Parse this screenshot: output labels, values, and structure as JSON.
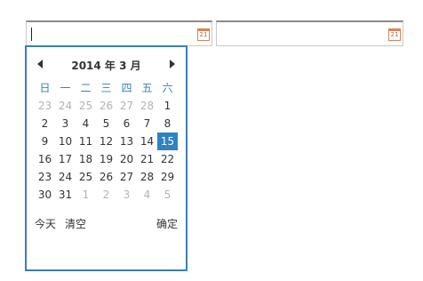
{
  "inputs": [
    {
      "value": "",
      "icon_text": "21"
    },
    {
      "value": "",
      "icon_text": "21"
    }
  ],
  "calendar": {
    "title": "2014 年 3 月",
    "weekdays": [
      "日",
      "一",
      "二",
      "三",
      "四",
      "五",
      "六"
    ],
    "weeks": [
      [
        {
          "d": "23",
          "m": true
        },
        {
          "d": "24",
          "m": true
        },
        {
          "d": "25",
          "m": true
        },
        {
          "d": "26",
          "m": true
        },
        {
          "d": "27",
          "m": true
        },
        {
          "d": "28",
          "m": true
        },
        {
          "d": "1"
        }
      ],
      [
        {
          "d": "2"
        },
        {
          "d": "3"
        },
        {
          "d": "4"
        },
        {
          "d": "5"
        },
        {
          "d": "6"
        },
        {
          "d": "7"
        },
        {
          "d": "8"
        }
      ],
      [
        {
          "d": "9"
        },
        {
          "d": "10"
        },
        {
          "d": "11"
        },
        {
          "d": "12"
        },
        {
          "d": "13"
        },
        {
          "d": "14"
        },
        {
          "d": "15",
          "s": true
        }
      ],
      [
        {
          "d": "16"
        },
        {
          "d": "17"
        },
        {
          "d": "18"
        },
        {
          "d": "19"
        },
        {
          "d": "20"
        },
        {
          "d": "21"
        },
        {
          "d": "22"
        }
      ],
      [
        {
          "d": "23"
        },
        {
          "d": "24"
        },
        {
          "d": "25"
        },
        {
          "d": "26"
        },
        {
          "d": "27"
        },
        {
          "d": "28"
        },
        {
          "d": "29"
        }
      ],
      [
        {
          "d": "30"
        },
        {
          "d": "31"
        },
        {
          "d": "1",
          "m": true
        },
        {
          "d": "2",
          "m": true
        },
        {
          "d": "3",
          "m": true
        },
        {
          "d": "4",
          "m": true
        },
        {
          "d": "5",
          "m": true
        }
      ]
    ],
    "today_label": "今天",
    "clear_label": "清空",
    "ok_label": "确定"
  },
  "colors": {
    "accent": "#3b7fb1",
    "selected_bg": "#2f83c2",
    "muted_text": "#b3b3b3",
    "icon": "#d4845a"
  }
}
